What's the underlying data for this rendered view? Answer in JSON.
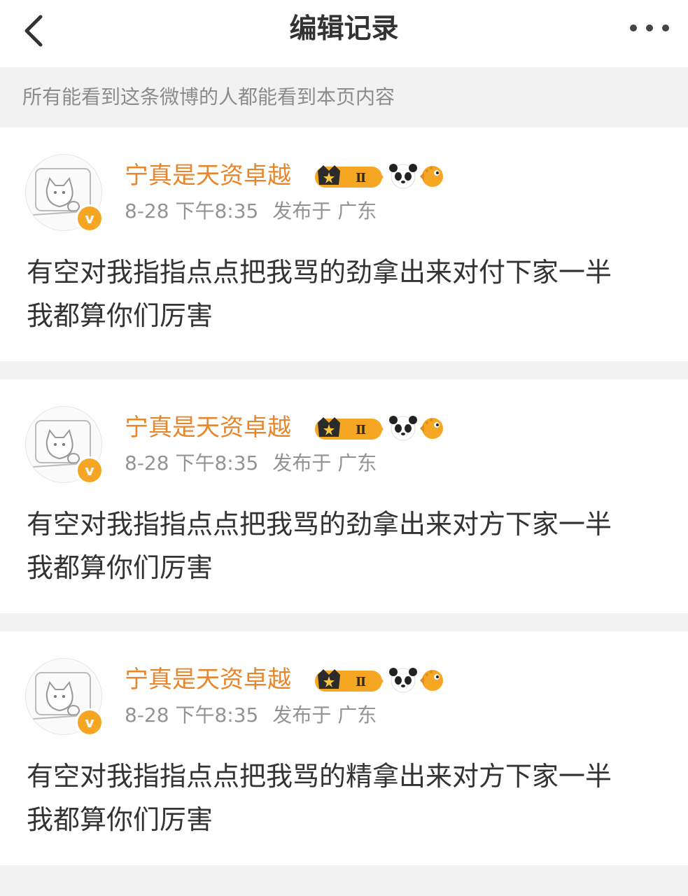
{
  "header": {
    "title": "编辑记录",
    "back_icon": "chevron-left-icon",
    "more_icon": "more-horizontal-icon"
  },
  "notice": "所有能看到这条微博的人都能看到本页内容",
  "colors": {
    "username": "#e8862c",
    "annotation": "#e3101a",
    "badge_gold": "#f5a623"
  },
  "records": [
    {
      "username": "宁真是天资卓越",
      "member_badge": "Ⅱ",
      "time": "8-28 下午8:35",
      "location": "发布于 广东",
      "line1": "有空对我指指点点把我骂的劲拿出来对付下家一半",
      "line2": "我都算你们厉害"
    },
    {
      "username": "宁真是天资卓越",
      "member_badge": "Ⅱ",
      "time": "8-28 下午8:35",
      "location": "发布于 广东",
      "line1": "有空对我指指点点把我骂的劲拿出来对方下家一半",
      "line2": "我都算你们厉害"
    },
    {
      "username": "宁真是天资卓越",
      "member_badge": "Ⅱ",
      "time": "8-28 下午8:35",
      "location": "发布于 广东",
      "line1": "有空对我指指点点把我骂的精拿出来对方下家一半",
      "line2": "我都算你们厉害"
    }
  ]
}
